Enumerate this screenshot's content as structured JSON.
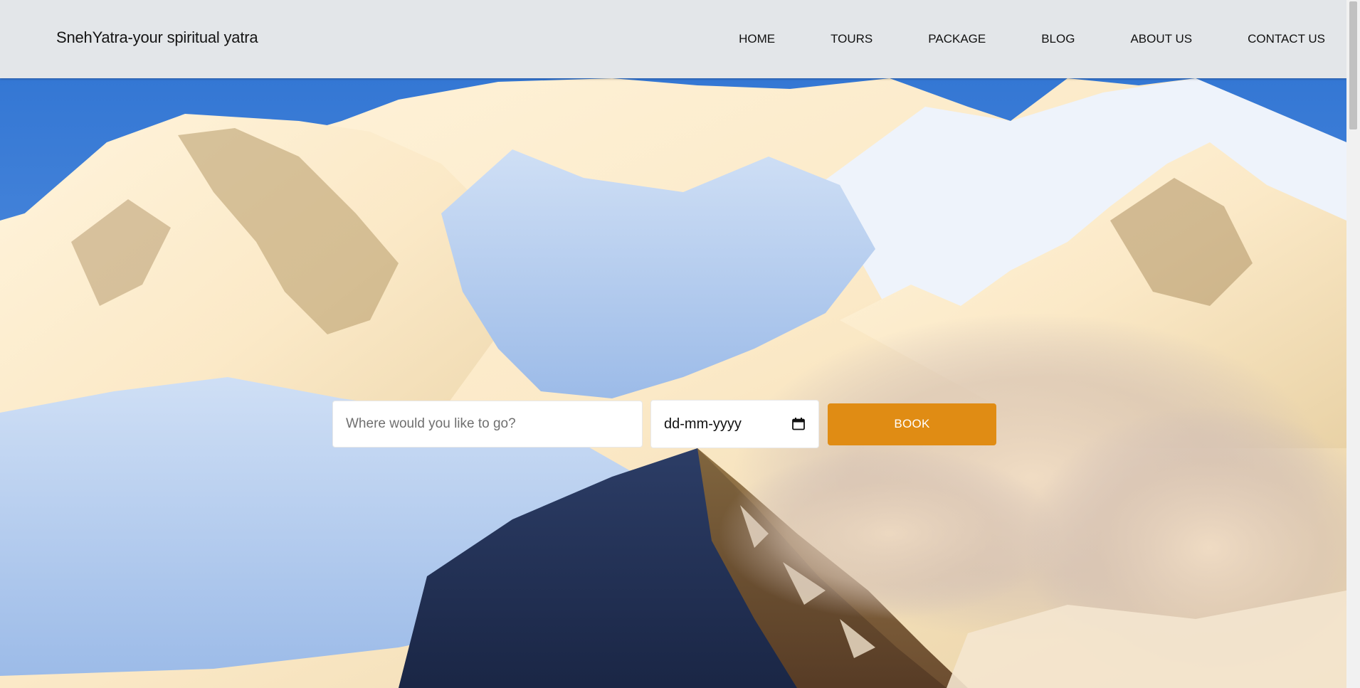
{
  "header": {
    "brand": "SnehYatra-your spiritual yatra",
    "nav": [
      {
        "label": "HOME"
      },
      {
        "label": "TOURS"
      },
      {
        "label": "PACKAGE"
      },
      {
        "label": "BLOG"
      },
      {
        "label": "ABOUT US"
      },
      {
        "label": "CONTACT US"
      }
    ]
  },
  "hero": {
    "background_image": "snowy-mountain-range-at-sunset"
  },
  "search": {
    "destination_placeholder": "Where would you like to go?",
    "destination_value": "",
    "date_value": "dd-mm-yyyy",
    "date_icon": "calendar-icon",
    "book_label": "BOOK"
  },
  "colors": {
    "header_bg": "#e3e6e9",
    "book_button": "#e08c14",
    "sky": "#3d7fd6"
  }
}
